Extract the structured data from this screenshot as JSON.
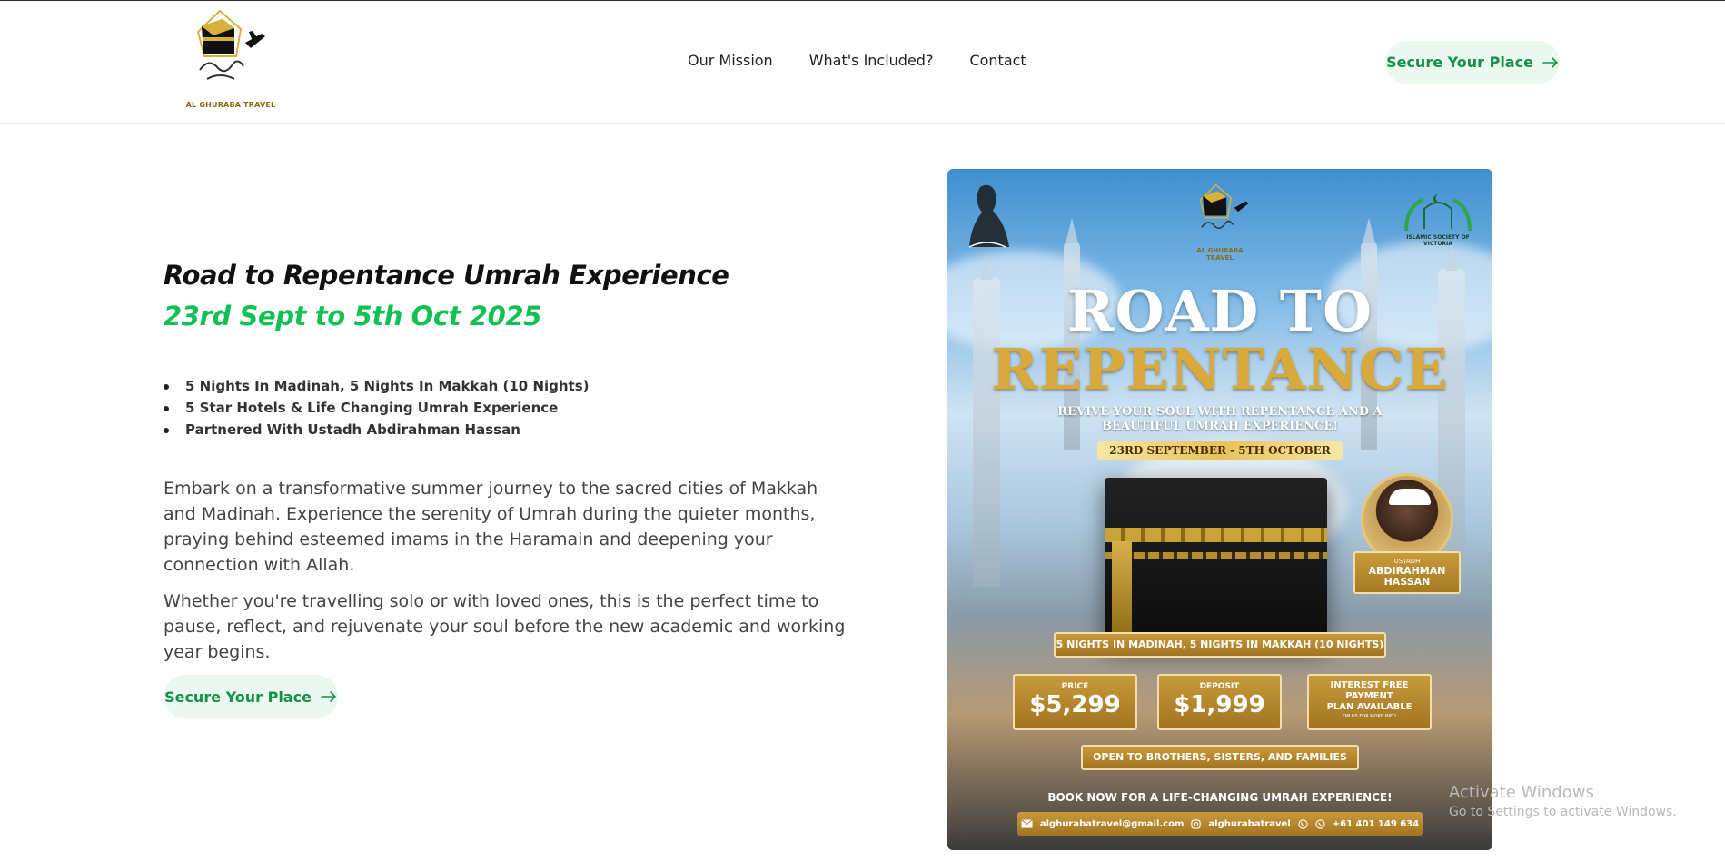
{
  "header": {
    "logo_caption": "AL GHURABA TRAVEL",
    "nav": [
      {
        "label": "Our Mission"
      },
      {
        "label": "What's Included?"
      },
      {
        "label": "Contact"
      }
    ],
    "cta_label": "Secure Your Place"
  },
  "hero": {
    "title": "Road to Repentance Umrah Experience",
    "dates": "23rd Sept to 5th Oct 2025",
    "bullets": [
      "5 Nights In Madinah, 5 Nights In Makkah (10 Nights)",
      "5 Star Hotels & Life Changing Umrah Experience",
      "Partnered With Ustadh Abdirahman Hassan"
    ],
    "paragraph1": "Embark on a transformative summer journey to the sacred cities of Makkah and Madinah. Experience the serenity of Umrah during the quieter months, praying behind esteemed imams in the Haramain and deepening your connection with Allah.",
    "paragraph2": "Whether you're travelling solo or with loved ones, this is the perfect time to pause, reflect, and rejuvenate your soul before the new academic and working year begins.",
    "cta_label": "Secure Your Place"
  },
  "poster": {
    "logo_caption": "AL GHURABA TRAVEL",
    "partner_caption": "ISLAMIC SOCIETY OF VICTORIA",
    "headline_1": "ROAD TO",
    "headline_2": "REPENTANCE",
    "subline_1": "REVIVE YOUR SOUL WITH REPENTANCE AND A",
    "subline_2": "BEAUTIFUL UMRAH EXPERIENCE!",
    "date_range": "23RD SEPTEMBER - 5TH OCTOBER",
    "ustadh_title": "USTADH",
    "ustadh_name_1": "ABDIRAHMAN",
    "ustadh_name_2": "HASSAN",
    "nights": "5 NIGHTS IN MADINAH, 5 NIGHTS IN MAKKAH (10 NIGHTS)",
    "price_label": "PRICE",
    "price_value": "$5,299",
    "deposit_label": "DEPOSIT",
    "deposit_value": "$1,999",
    "plan_line_1": "INTEREST FREE",
    "plan_line_2": "PAYMENT",
    "plan_line_3": "PLAN AVAILABLE",
    "plan_note": "DM US FOR MORE INFO",
    "open_to": "OPEN TO BROTHERS, SISTERS, AND FAMILIES",
    "book_now": "BOOK NOW FOR A LIFE-CHANGING UMRAH EXPERIENCE!",
    "email": "alghurabatravel@gmail.com",
    "instagram": "alghurabatravel",
    "phone": "+61 401 149 634"
  },
  "watermark": {
    "title": "Activate Windows",
    "subtitle": "Go to Settings to activate Windows."
  },
  "colors": {
    "accent_green": "#12c154",
    "cta_text": "#14924a",
    "cta_bg": "#eaf8ef",
    "gold": "#c99a3c"
  }
}
